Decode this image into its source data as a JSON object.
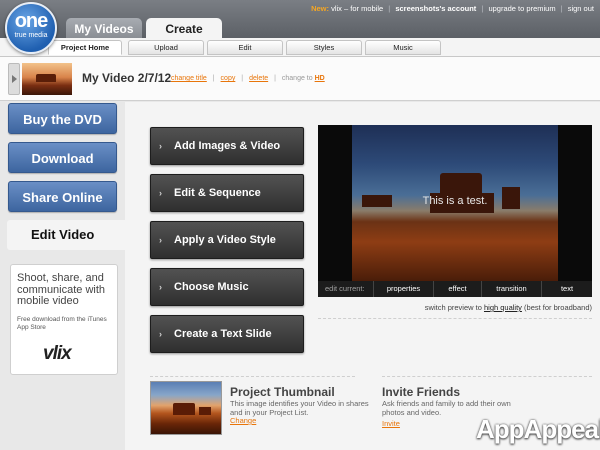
{
  "logo": {
    "line1": "one",
    "line2": "true media"
  },
  "main_tabs": [
    {
      "label": "My Videos"
    },
    {
      "label": "Create"
    }
  ],
  "top_nav": {
    "new_label": "New:",
    "mobile_text": "vlix – for mobile",
    "account": "screenshots's account",
    "upgrade": "upgrade to premium",
    "signout": "sign out"
  },
  "sub_tabs": [
    "Project Home",
    "Upload",
    "Edit",
    "Styles",
    "Music"
  ],
  "video": {
    "title": "My Video 2/7/12",
    "change_title": "change title",
    "copy": "copy",
    "delete": "delete",
    "change_to": "change to",
    "hd": "HD"
  },
  "sidebar": {
    "buttons": [
      "Buy the DVD",
      "Download",
      "Share Online"
    ],
    "active": "Edit Video",
    "promo": {
      "headline": "Shoot, share, and communicate with mobile video",
      "sub": "Free download from the iTunes App Store",
      "brand": "vlix"
    }
  },
  "steps": [
    "Add Images & Video",
    "Edit & Sequence",
    "Apply a Video Style",
    "Choose Music",
    "Create a Text Slide"
  ],
  "preview": {
    "text": "This is a test.",
    "edit_current": "edit current:",
    "tabs": [
      "properties",
      "effect",
      "transition",
      "text"
    ],
    "switch_pre": "switch preview to",
    "switch_link": "high quality",
    "switch_post": "(best for broadband)"
  },
  "thumbnail_section": {
    "title": "Project Thumbnail",
    "body": "This image identifies your Video in shares and in your Project List.",
    "link": "Change"
  },
  "invite_section": {
    "title": "Invite Friends",
    "body": "Ask friends and family to add their own photos and video.",
    "link": "Invite"
  },
  "watermark": "AppAppeal"
}
